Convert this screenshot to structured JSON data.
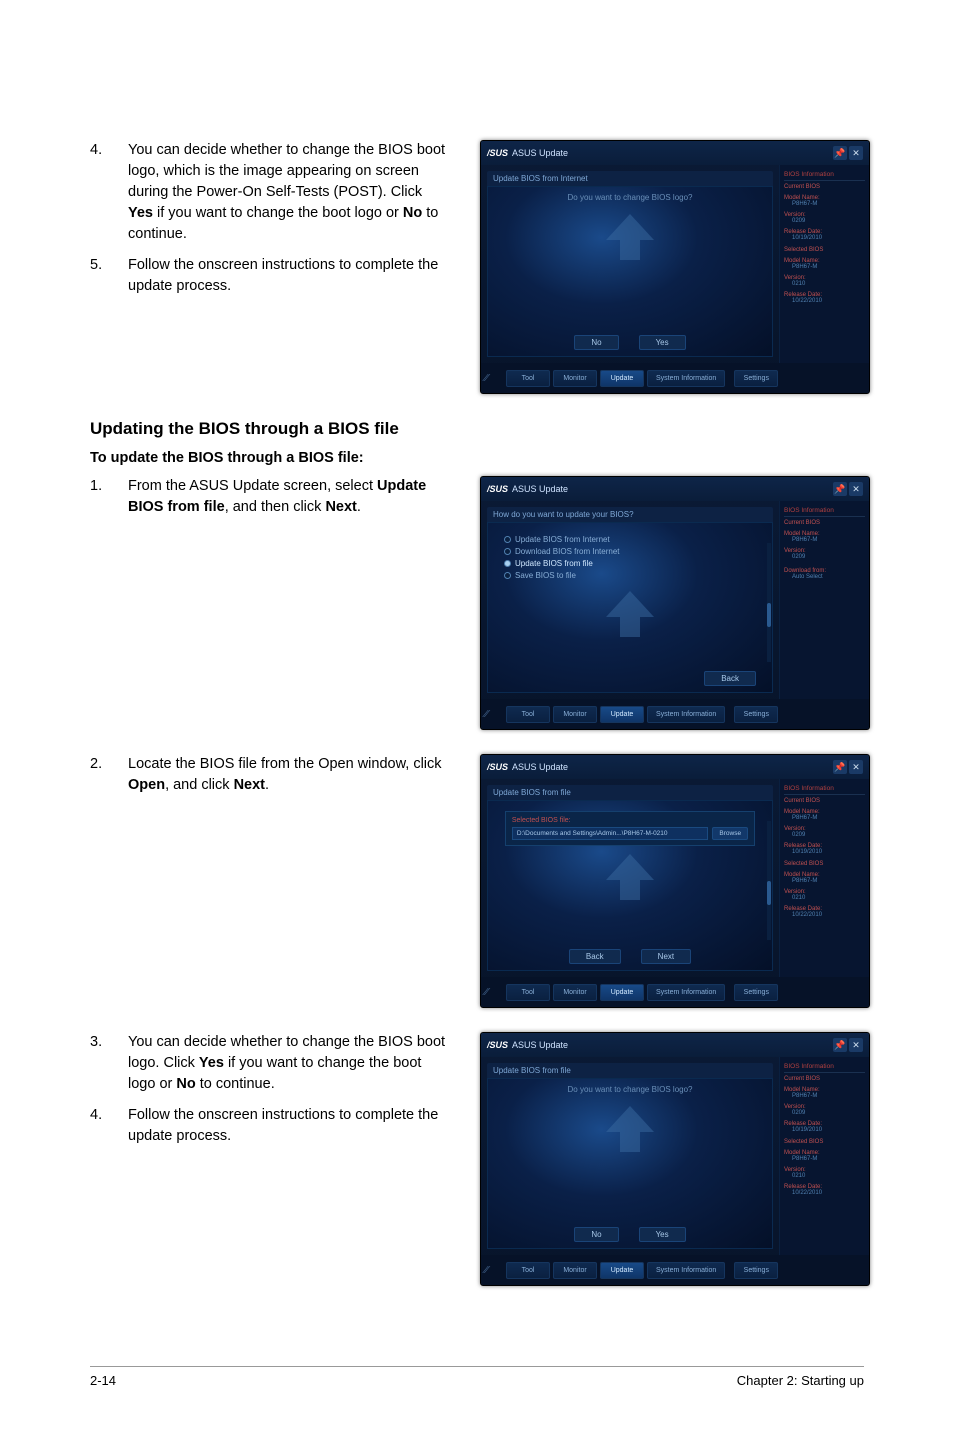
{
  "steps_top": [
    {
      "num": "4.",
      "text_parts": [
        "You can decide whether to change the BIOS boot logo, which is the image appearing on screen during the Power-On Self-Tests (POST). Click ",
        {
          "b": "Yes"
        },
        " if you want to change the boot logo or ",
        {
          "b": "No"
        },
        " to continue."
      ]
    },
    {
      "num": "5.",
      "text_parts": [
        "Follow the onscreen instructions to complete the update process."
      ]
    }
  ],
  "section_heading": "Updating the BIOS through a BIOS file",
  "sub_heading": "To update the BIOS through a BIOS file:",
  "steps_mid": [
    {
      "num": "1.",
      "text_parts": [
        "From the ASUS Update screen, select ",
        {
          "b": "Update BIOS from file"
        },
        ", and then click ",
        {
          "b": "Next"
        },
        "."
      ]
    }
  ],
  "steps_mid2": [
    {
      "num": "2.",
      "text_parts": [
        "Locate the BIOS file from the Open window, click ",
        {
          "b": "Open"
        },
        ", and click ",
        {
          "b": "Next"
        },
        "."
      ]
    }
  ],
  "steps_bottom": [
    {
      "num": "3.",
      "text_parts": [
        "You can decide whether to change the BIOS boot logo. Click ",
        {
          "b": "Yes"
        },
        " if you want to change the boot logo or ",
        {
          "b": "No"
        },
        " to continue."
      ]
    },
    {
      "num": "4.",
      "text_parts": [
        "Follow the onscreen instructions to complete the update process."
      ]
    }
  ],
  "footer": {
    "left": "2-14",
    "right": "Chapter 2: Starting up"
  },
  "asus_common": {
    "logo": "/SUS",
    "title": "ASUS Update",
    "pin": "📌",
    "close": "✕",
    "info_header": "BIOS Information",
    "info": {
      "current_bios_lbl": "Current BIOS",
      "model_lbl": "Model Name:",
      "model_val": "P8H67-M",
      "version_lbl": "Version:",
      "version_val": "0209",
      "date_lbl": "Release Date:",
      "date_val": "10/19/2010",
      "sel_bios_lbl": "Selected BIOS",
      "sel_model_val": "P8H67-M",
      "sel_version_val": "0210",
      "sel_date_val": "10/22/2010"
    },
    "tabs": {
      "tool": "Tool",
      "monitor": "Monitor",
      "update": "Update",
      "system": "System\nInformation",
      "settings": "Settings"
    }
  },
  "screen1": {
    "tab": "Update BIOS from Internet",
    "prompt": "Do you want to change BIOS logo?",
    "btn_no": "No",
    "btn_yes": "Yes"
  },
  "screen2": {
    "tab": "How do you want to update your BIOS?",
    "options": [
      "Update BIOS from Internet",
      "Download BIOS from Internet",
      "Update BIOS from file",
      "Save BIOS to file"
    ],
    "selected_index": 2,
    "btn_back": "Back",
    "download_lbl": "Download from:",
    "download_val": "Auto Select"
  },
  "screen3": {
    "tab": "Update BIOS from file",
    "file_label": "Selected BIOS file:",
    "file_path": "D:\\Documents and Settings\\Admin...\\P8H67-M-0210",
    "browse": "Browse",
    "btn_back": "Back",
    "btn_next": "Next"
  },
  "screen4": {
    "tab": "Update BIOS from file",
    "prompt": "Do you want to change BIOS logo?",
    "btn_no": "No",
    "btn_yes": "Yes"
  }
}
